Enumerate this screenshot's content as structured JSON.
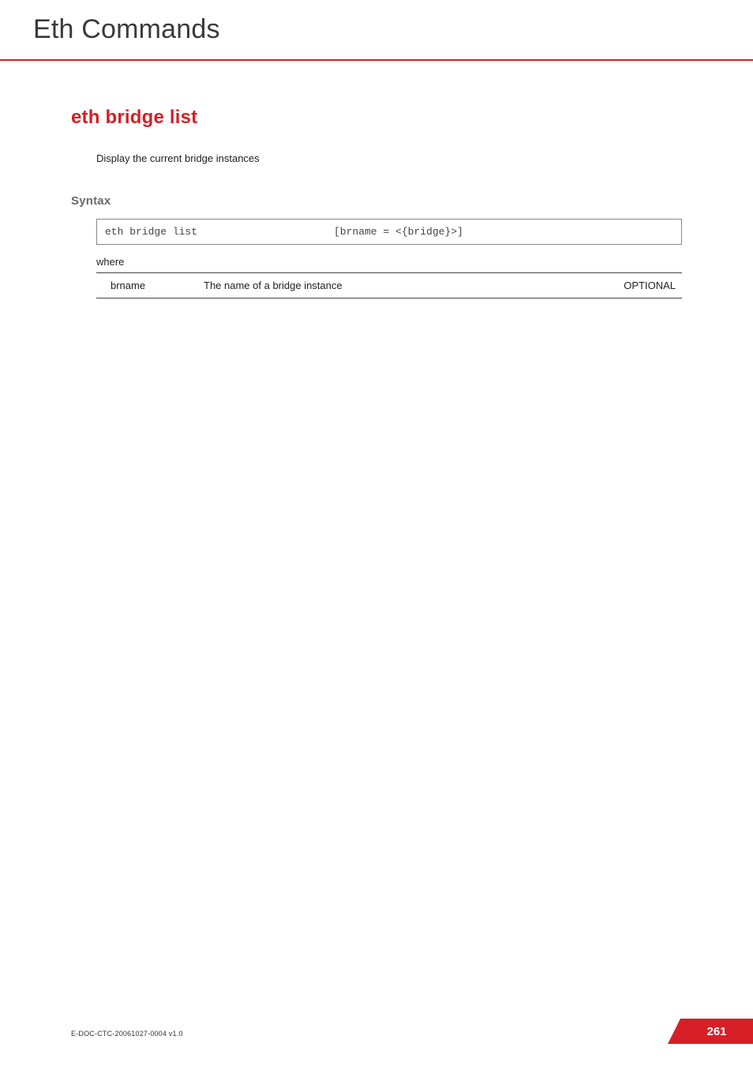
{
  "header": {
    "breadcrumb": "Eth Commands"
  },
  "command": {
    "title": "eth bridge list",
    "description": "Display the current bridge instances"
  },
  "syntax": {
    "label": "Syntax",
    "command": "eth bridge list",
    "args": "[brname = <{bridge}>]",
    "where_label": "where",
    "params": [
      {
        "name": "brname",
        "desc": "The name of a bridge instance",
        "flag": "OPTIONAL"
      }
    ]
  },
  "footer": {
    "docid": "E-DOC-CTC-20061027-0004 v1.0",
    "page": "261"
  }
}
